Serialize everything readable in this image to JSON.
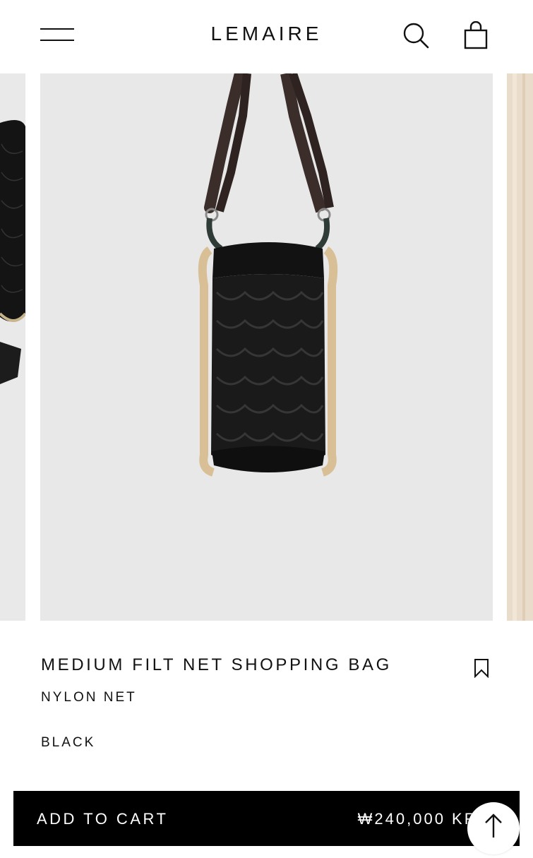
{
  "header": {
    "brand": "LEMAIRE",
    "menu_icon": "hamburger-menu-icon",
    "search_icon": "search-icon",
    "bag_icon": "shopping-bag-icon"
  },
  "carousel": {
    "slides_visible": 3,
    "main_background": "#e8e8e8",
    "next_background": "#eadccb"
  },
  "product": {
    "name": "MEDIUM FILT NET SHOPPING BAG",
    "material": "NYLON NET",
    "color": "BLACK",
    "bookmark_icon": "bookmark-icon"
  },
  "cart": {
    "button_label": "ADD TO CART",
    "price": "₩240,000 KRW"
  },
  "scroll_top_icon": "arrow-up-icon"
}
